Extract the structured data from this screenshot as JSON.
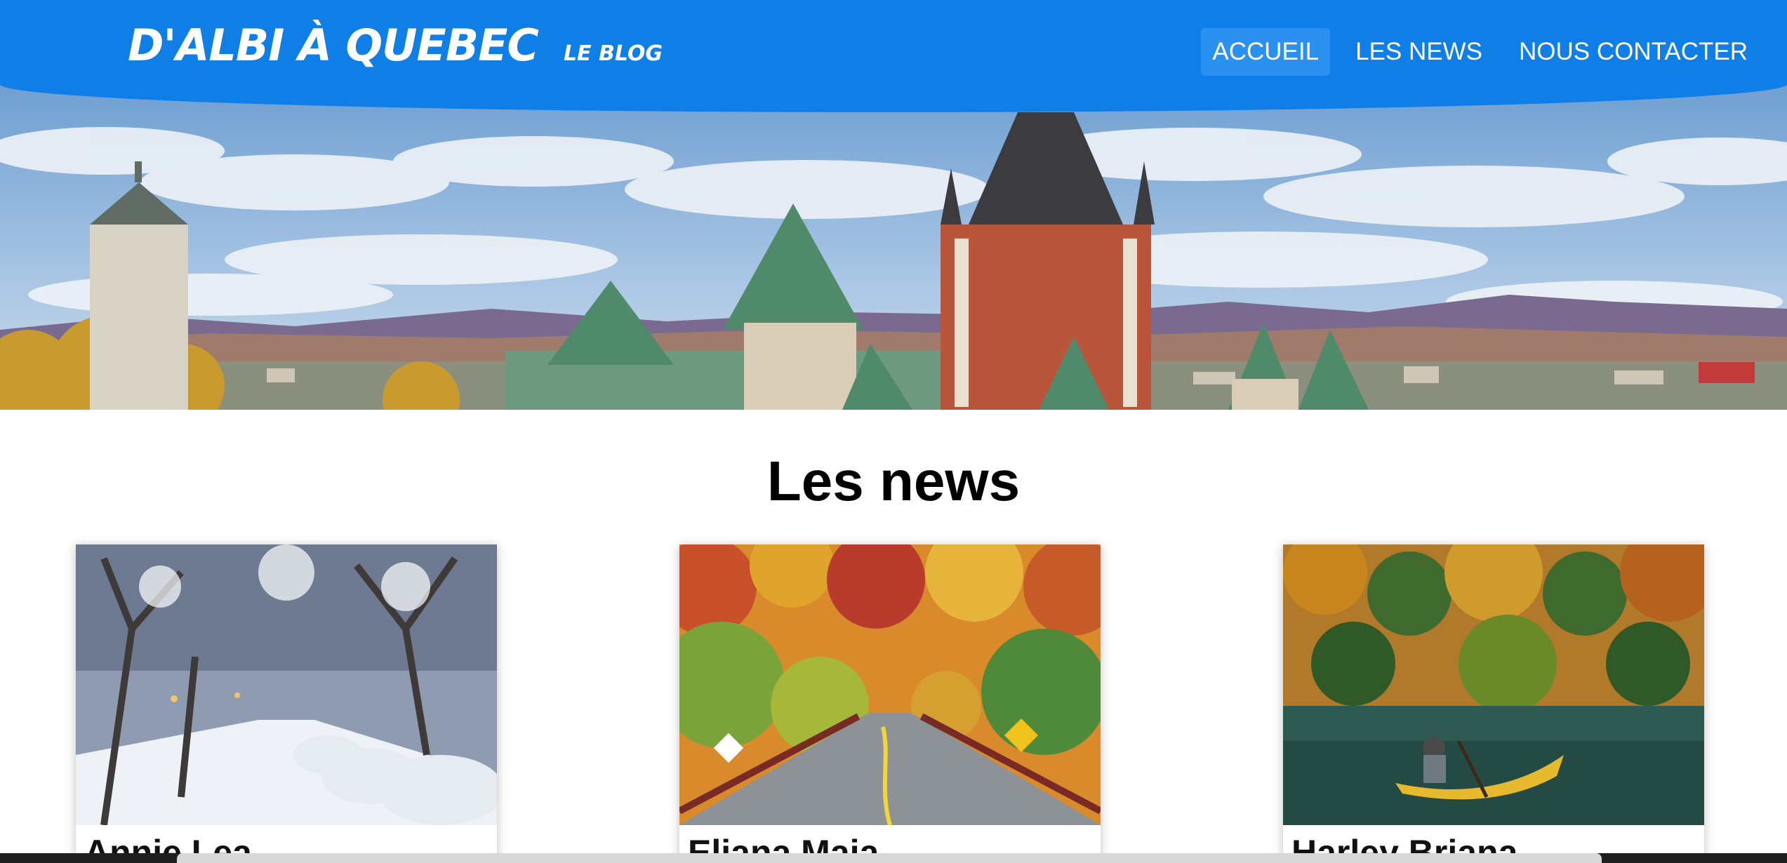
{
  "header": {
    "brand_title": "D'ALBI À QUEBEC",
    "brand_subtitle": "LE BLOG",
    "nav": [
      {
        "label": "ACCUEIL",
        "active": true
      },
      {
        "label": "LES NEWS",
        "active": false
      },
      {
        "label": "NOUS CONTACTER",
        "active": false
      }
    ],
    "color": "#0f7ee6"
  },
  "hero": {
    "scene": "quebec-city-skyline-chateau-frontenac"
  },
  "news": {
    "title": "Les news",
    "cards": [
      {
        "name": "Annie Lea",
        "image": "snowy-street"
      },
      {
        "name": "Eliana Maia",
        "image": "autumn-road"
      },
      {
        "name": "Harley Briana",
        "image": "canoe-lake"
      }
    ]
  }
}
